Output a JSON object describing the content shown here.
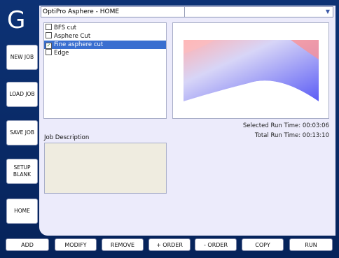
{
  "app": {
    "logo": "G",
    "title": "OptiPro Asphere - HOME"
  },
  "nav": {
    "new_job": "NEW JOB",
    "load_job": "LOAD JOB",
    "save_job": "SAVE JOB",
    "setup_blank_line1": "SETUP",
    "setup_blank_line2": "BLANK",
    "home": "HOME"
  },
  "operations": [
    {
      "label": "BFS cut",
      "checked": false,
      "selected": false
    },
    {
      "label": "Asphere Cut",
      "checked": false,
      "selected": false
    },
    {
      "label": "Fine asphere cut",
      "checked": true,
      "selected": true
    },
    {
      "label": "Edge",
      "checked": false,
      "selected": false
    }
  ],
  "run_times": {
    "selected": "Selected Run Time: 00:03:06",
    "total": "Total Run Time: 00:13:10"
  },
  "job_description": {
    "label": "Job Description",
    "value": ""
  },
  "toolbar": {
    "add": "ADD",
    "modify": "MODIFY",
    "remove": "REMOVE",
    "plus_order": "+ ORDER",
    "minus_order": "- ORDER",
    "copy": "COPY",
    "run": "RUN"
  },
  "colors": {
    "background": "#0d3275",
    "panel": "#ecebfb",
    "selection": "#3a6fd0",
    "preview_top": "#ff9a9a",
    "preview_bottom": "#5b5cf5"
  },
  "icons": {
    "dropdown": "chevron-down-icon",
    "check": "checkmark-icon"
  }
}
